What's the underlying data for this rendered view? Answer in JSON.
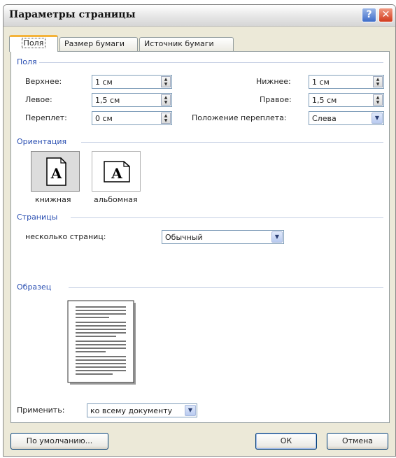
{
  "window": {
    "title": "Параметры страницы",
    "help_icon": "question-mark",
    "close_icon": "close-x"
  },
  "tabs": [
    {
      "label": "Поля",
      "active": true
    },
    {
      "label": "Размер бумаги",
      "active": false
    },
    {
      "label": "Источник бумаги",
      "active": false
    }
  ],
  "margins": {
    "group_label": "Поля",
    "top_label": "Верхнее:",
    "top_value": "1 см",
    "bottom_label": "Нижнее:",
    "bottom_value": "1 см",
    "left_label": "Левое:",
    "left_value": "1,5 см",
    "right_label": "Правое:",
    "right_value": "1,5 см",
    "gutter_label": "Переплет:",
    "gutter_value": "0 см",
    "gutter_pos_label": "Положение переплета:",
    "gutter_pos_value": "Слева"
  },
  "orientation": {
    "group_label": "Ориентация",
    "portrait_label": "книжная",
    "landscape_label": "альбомная",
    "icon_letter": "A",
    "selected": "portrait"
  },
  "pages": {
    "group_label": "Страницы",
    "multiple_label": "несколько страниц:",
    "multiple_value": "Обычный"
  },
  "preview": {
    "group_label": "Образец"
  },
  "apply": {
    "label": "Применить:",
    "value": "ко всему документу"
  },
  "buttons": {
    "default_label": "По умолчанию...",
    "ok_label": "ОК",
    "cancel_label": "Отмена"
  },
  "colors": {
    "group_label": "#2a4fb2",
    "active_tab_accent": "#f4b33a",
    "close_button": "#d23a1c",
    "help_button": "#3d6cc9"
  }
}
